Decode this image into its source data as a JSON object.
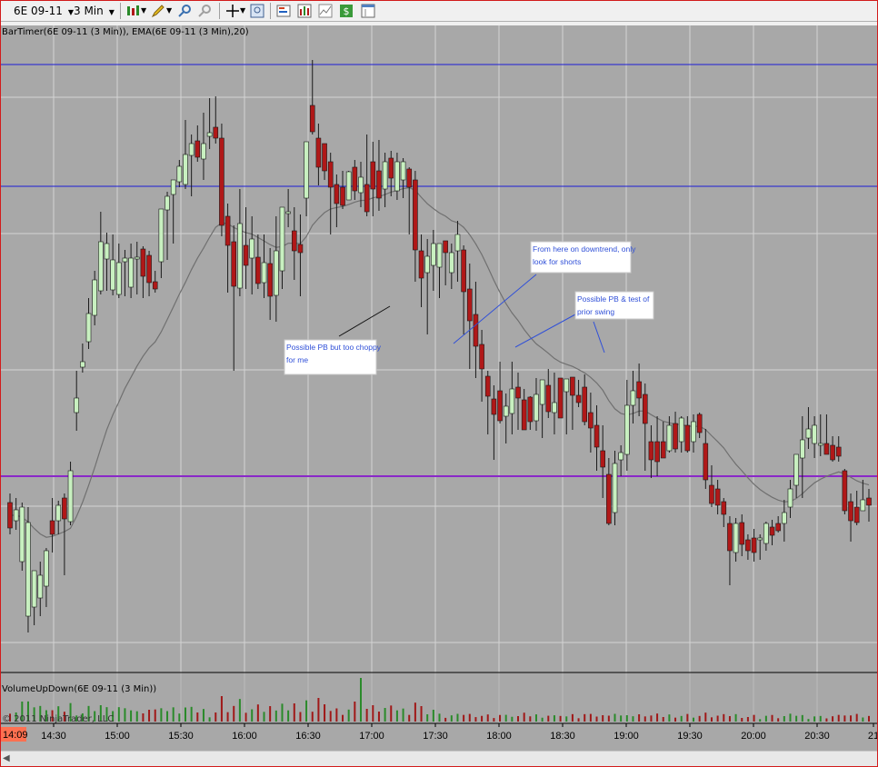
{
  "toolbar": {
    "instrument": "6E 09-11",
    "interval": "3 Min",
    "icons": [
      "bar-style-icon",
      "pencil-draw-icon",
      "zoom-in-icon",
      "zoom-out-icon",
      "crosshair-icon",
      "magnifier-icon",
      "data-box-icon",
      "indicators-icon",
      "strategies-icon",
      "dollar-icon",
      "properties-icon"
    ]
  },
  "chart": {
    "price_panel_label": "BarTimer(6E 09-11 (3 Min)), EMA(6E 09-11 (3 Min),20)",
    "volume_panel_label": "VolumeUpDown(6E 09-11 (3 Min))",
    "copyright": "© 2011 NinjaTrader, LLC",
    "time_labels": [
      "14:09",
      "14:30",
      "15:00",
      "15:30",
      "16:00",
      "16:30",
      "17:00",
      "17:30",
      "18:00",
      "18:30",
      "19:00",
      "19:30",
      "20:00",
      "20:30",
      "21"
    ],
    "current_time_badge": "14:09",
    "annotations": [
      {
        "id": "choppy",
        "lines": [
          "Possible PB but too choppy",
          "for me"
        ]
      },
      {
        "id": "downtrend",
        "lines": [
          "From here on downtrend, only",
          "look for shorts"
        ]
      },
      {
        "id": "retest",
        "lines": [
          "Possible PB & test of",
          "prior swing"
        ]
      }
    ],
    "colors": {
      "background": "#a8a8a8",
      "grid": "#d4d4d4",
      "up_bar": "#c8f0c0",
      "down_bar": "#b01818",
      "wick": "#1a1a1a",
      "ema": "#707070",
      "blue_level": "#1c1cd6",
      "purple_level": "#8a28c8",
      "vol_up": "#2a8a2a",
      "vol_down": "#a01818",
      "note_text": "#3050d8"
    }
  },
  "chart_data": {
    "type": "candlestick",
    "x_labels": [
      "14:30",
      "15:00",
      "15:30",
      "16:00",
      "16:30",
      "17:00",
      "17:30",
      "18:00",
      "18:30",
      "19:00",
      "19:30",
      "20:00",
      "20:30"
    ],
    "horizontal_levels": [
      "blue",
      "blue",
      "purple"
    ],
    "series": [
      {
        "name": "EMA(6E 09-11 (3 Min),20)"
      },
      {
        "name": "VolumeUpDown(6E 09-11 (3 Min))"
      }
    ]
  }
}
